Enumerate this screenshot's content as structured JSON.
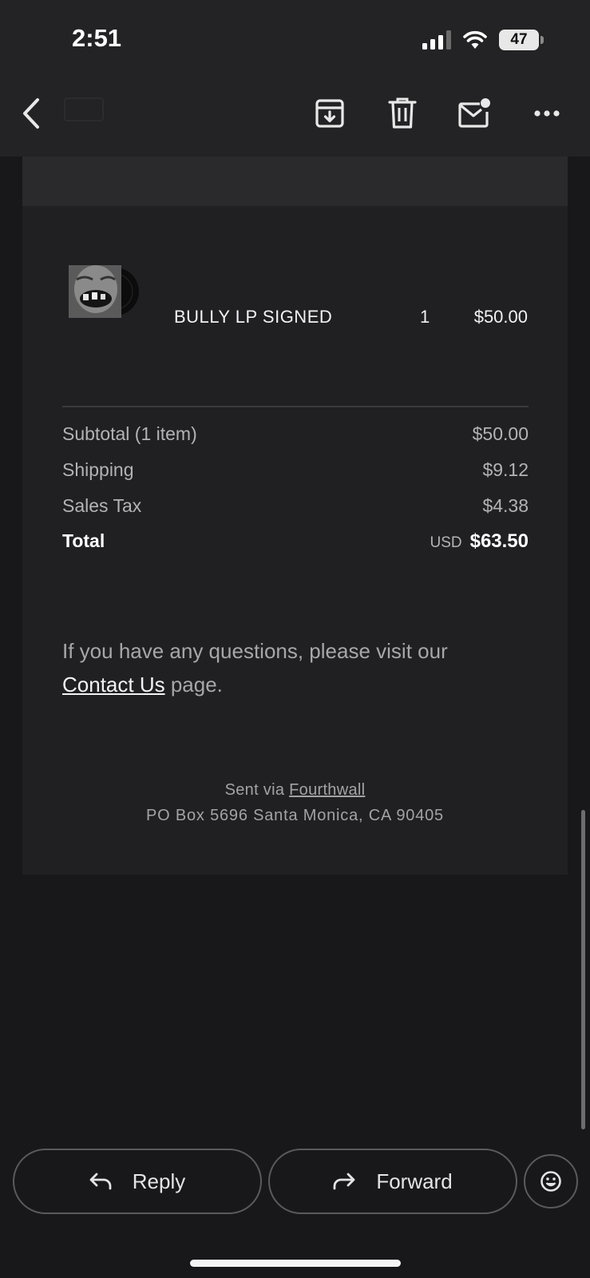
{
  "status_bar": {
    "time": "2:51",
    "battery": "47"
  },
  "header": {
    "back_icon": "chevron-left-icon",
    "actions": [
      "archive-icon",
      "trash-icon",
      "mark-unread-icon",
      "more-icon"
    ]
  },
  "order": {
    "item": {
      "name": "BULLY LP SIGNED",
      "quantity": "1",
      "price": "$50.00"
    },
    "summary": [
      {
        "label": "Subtotal (1 item)",
        "value": "$50.00"
      },
      {
        "label": "Shipping",
        "value": "$9.12"
      },
      {
        "label": "Sales Tax",
        "value": "$4.38"
      }
    ],
    "total": {
      "label": "Total",
      "currency": "USD",
      "amount": "$63.50"
    }
  },
  "message": {
    "questions_prefix": "If you have any questions, please visit our",
    "contact_link": "Contact Us",
    "questions_suffix": " page."
  },
  "footer": {
    "sent_via": "Sent via ",
    "brand": "Fourthwall",
    "address": "PO Box 5696 Santa Monica, CA 90405"
  },
  "actions": {
    "reply": "Reply",
    "forward": "Forward",
    "emoji_icon": "smiley-icon"
  },
  "colors": {
    "background": "#18181a",
    "card": "#202023",
    "topbar": "#232325",
    "text": "#f2f2f2",
    "muted": "#b3b3b6"
  }
}
